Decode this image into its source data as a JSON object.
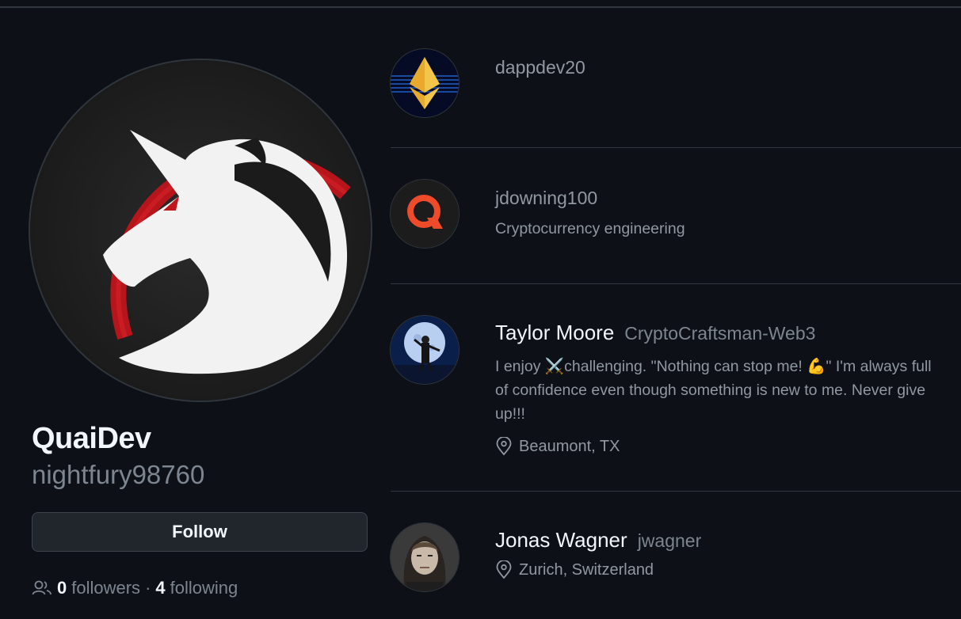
{
  "profile": {
    "name": "QuaiDev",
    "login": "nightfury98760",
    "follow_button": "Follow",
    "followers_count": "0",
    "followers_label": "followers",
    "separator": "·",
    "following_count": "4",
    "following_label": "following"
  },
  "following": [
    {
      "display_name": "",
      "login": "dappdev20",
      "bio": "",
      "location": "",
      "avatar": "ethereum-diamond-avatar"
    },
    {
      "display_name": "",
      "login": "jdowning100",
      "bio": "Cryptocurrency engineering",
      "location": "",
      "avatar": "orange-q-logo-avatar"
    },
    {
      "display_name": "Taylor Moore",
      "login": "CryptoCraftsman-Web3",
      "bio": "I enjoy ⚔️challenging. \"Nothing can stop me! 💪\" I'm always full of confidence even though something is new to me. Never give up!!!",
      "location": "Beaumont, TX",
      "avatar": "moon-figure-avatar"
    },
    {
      "display_name": "Jonas Wagner",
      "login": "jwagner",
      "bio": "",
      "location": "Zurich, Switzerland",
      "avatar": "portrait-photo-avatar"
    }
  ],
  "colors": {
    "background": "#0d1117",
    "border": "#30363d",
    "text_primary": "#f0f6fc",
    "text_muted": "#7d8590",
    "avatar_red_ring": "#c0171d"
  }
}
